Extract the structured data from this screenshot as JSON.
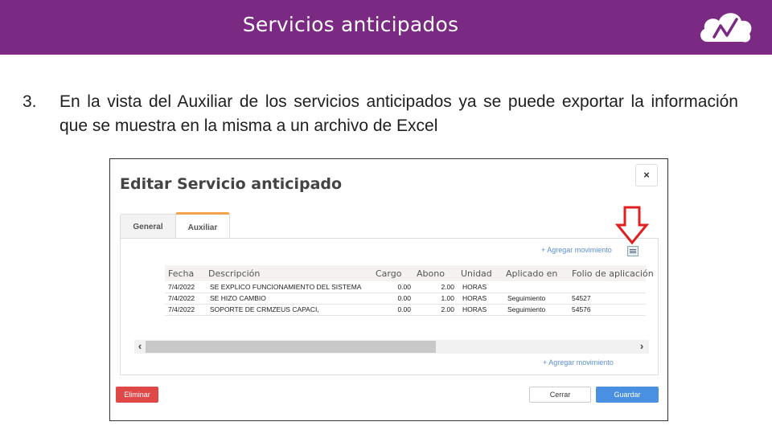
{
  "header": {
    "title": "Servicios anticipados",
    "background_color": "#7b2a84",
    "logo_icon": "cloud-logo-icon"
  },
  "body": {
    "step_number": "3.",
    "step_text": "En la vista del Auxiliar de los servicios anticipados ya se puede exportar la información que se muestra en la misma a un archivo de Excel"
  },
  "modal": {
    "title": "Editar Servicio anticipado",
    "close_label": "×",
    "tabs": [
      {
        "label": "General",
        "active": false
      },
      {
        "label": "Auxiliar",
        "active": true
      }
    ],
    "add_movement_label": "+ Agregar movimiento",
    "export_icon": "excel-export-icon",
    "annotation_icon": "red-down-arrow-icon",
    "columns": [
      "Fecha",
      "Descripción",
      "Cargo",
      "Abono",
      "Unidad",
      "Aplicado en",
      "Folio de aplicación"
    ],
    "rows": [
      {
        "fecha": "7/4/2022",
        "descripcion": "SE EXPLICO FUNCIONAMIENTO DEL SISTEMA",
        "cargo": "0.00",
        "abono": "2.00",
        "unidad": "HORAS",
        "aplicado": "",
        "folio": ""
      },
      {
        "fecha": "7/4/2022",
        "descripcion": "SE HIZO CAMBIO",
        "cargo": "0.00",
        "abono": "1.00",
        "unidad": "HORAS",
        "aplicado": "Seguimiento",
        "folio": "54527"
      },
      {
        "fecha": "7/4/2022",
        "descripcion": "SOPORTE DE CRMZEUS CAPACI,",
        "cargo": "0.00",
        "abono": "2.00",
        "unidad": "HORAS",
        "aplicado": "Seguimiento",
        "folio": "54576"
      }
    ],
    "scroll_left": "‹",
    "scroll_right": "›",
    "buttons": {
      "delete": "Eliminar",
      "cancel": "Cerrar",
      "save": "Guardar"
    },
    "colors": {
      "delete": "#e04848",
      "save": "#4a90e2",
      "active_tab_accent": "#f3a24a",
      "link": "#5b8fd6"
    }
  }
}
